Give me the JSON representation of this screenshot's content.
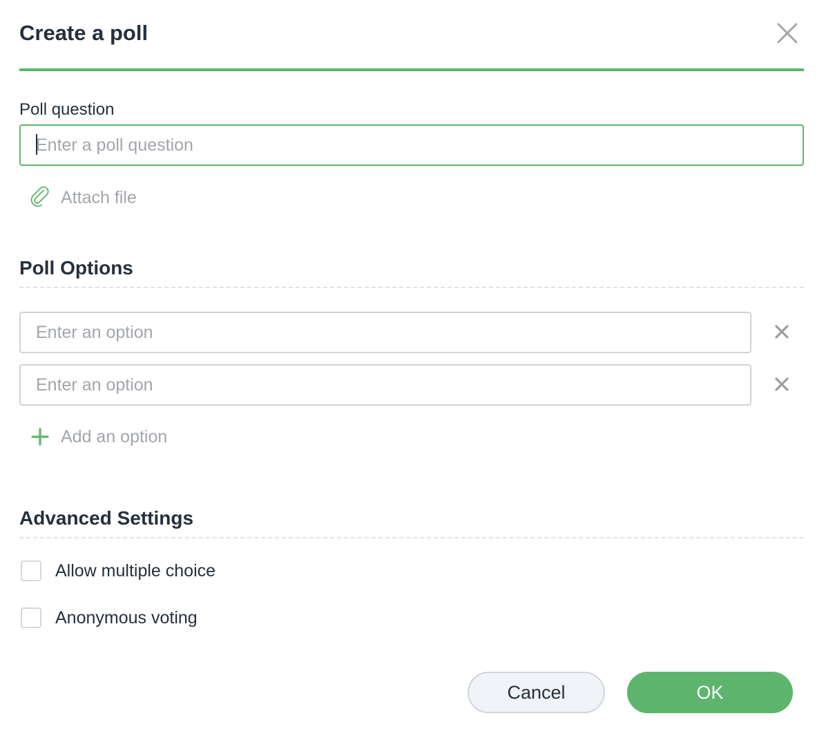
{
  "dialog": {
    "title": "Create a poll",
    "close_icon": "close-icon"
  },
  "question": {
    "label": "Poll question",
    "value": "",
    "placeholder": "Enter a poll question"
  },
  "attach": {
    "label": "Attach file",
    "icon": "paperclip-icon"
  },
  "poll_options": {
    "title": "Poll Options",
    "options": [
      {
        "value": "",
        "placeholder": "Enter an option",
        "remove_icon": "close-icon"
      },
      {
        "value": "",
        "placeholder": "Enter an option",
        "remove_icon": "close-icon"
      }
    ],
    "add_label": "Add an option",
    "add_icon": "plus-icon"
  },
  "advanced": {
    "title": "Advanced Settings",
    "settings": [
      {
        "label": "Allow multiple choice",
        "checked": false
      },
      {
        "label": "Anonymous voting",
        "checked": false
      }
    ]
  },
  "footer": {
    "cancel_label": "Cancel",
    "ok_label": "OK"
  },
  "colors": {
    "accent": "#5db56d",
    "text": "#24303c",
    "muted": "#a2a6ab"
  }
}
